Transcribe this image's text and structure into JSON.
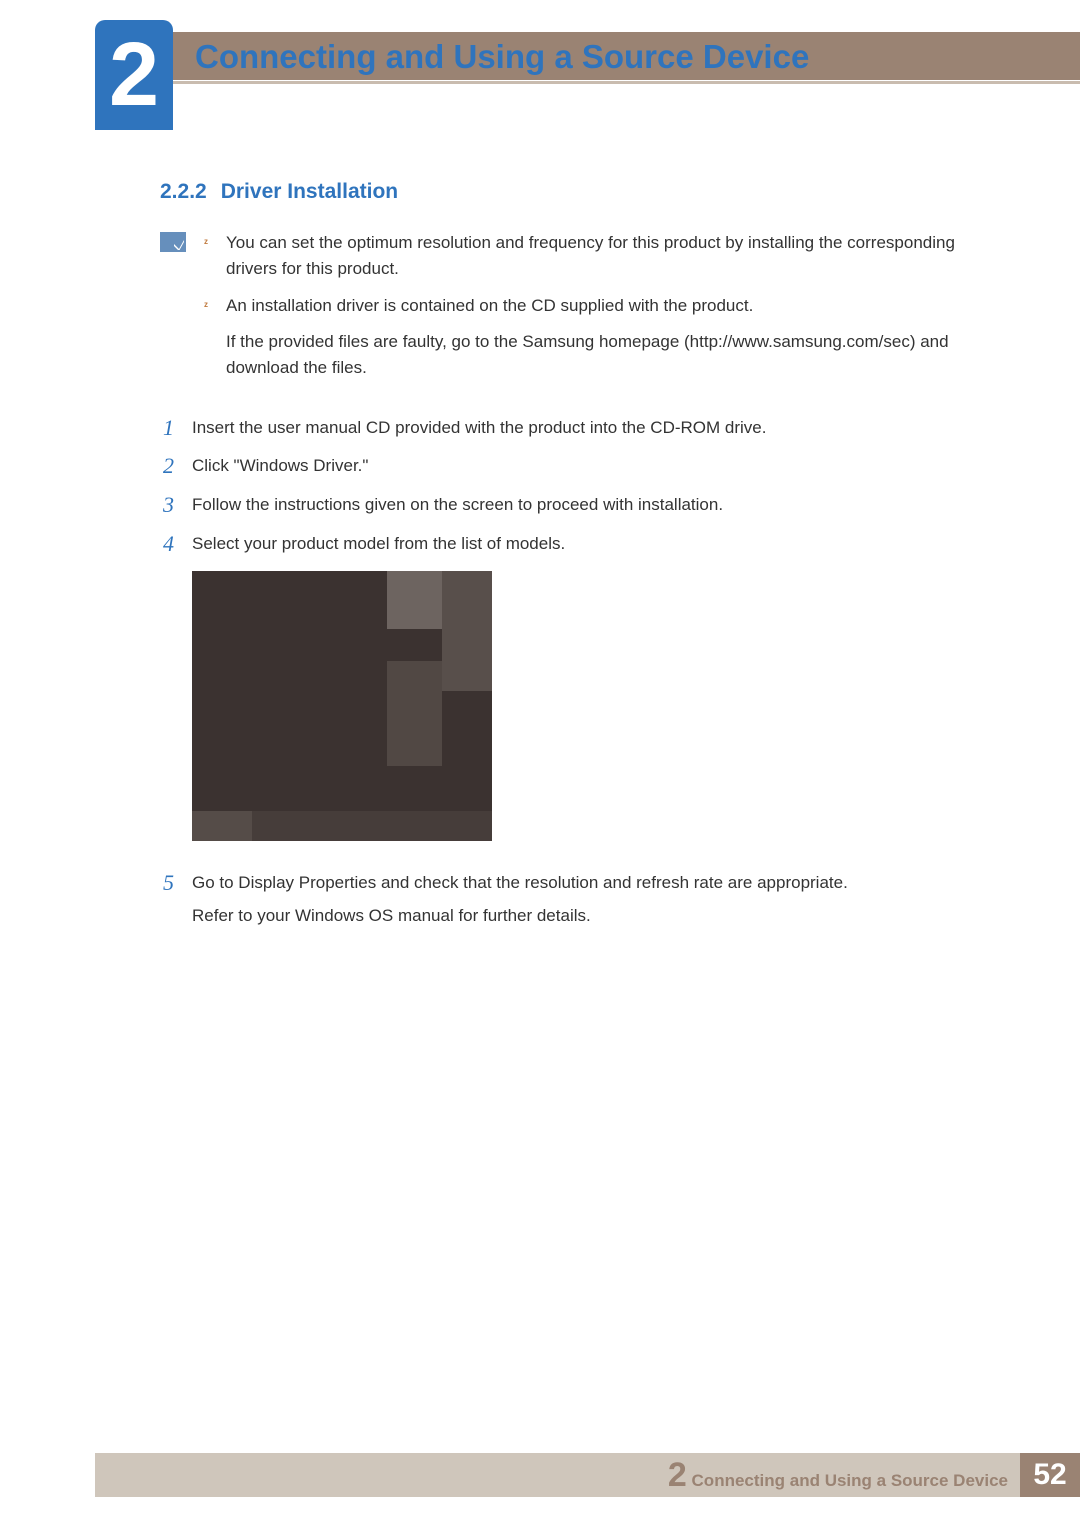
{
  "chapter": {
    "number": "2",
    "title": "Connecting and Using a Source Device"
  },
  "section": {
    "number": "2.2.2",
    "title": "Driver Installation"
  },
  "notes": [
    "You can set the optimum resolution and frequency for this product by installing the corresponding drivers for this product.",
    "An installation driver is contained on the CD supplied with the product."
  ],
  "note_supplement": "If the provided files are faulty, go to the Samsung homepage (http://www.samsung.com/sec) and download the files.",
  "steps": [
    {
      "n": "1",
      "text": "Insert the user manual CD provided with the product into the CD-ROM drive."
    },
    {
      "n": "2",
      "text": "Click \"Windows Driver.\""
    },
    {
      "n": "3",
      "text": "Follow the instructions given on the screen to proceed with installation."
    },
    {
      "n": "4",
      "text": "Select your product model from the list of models."
    },
    {
      "n": "5",
      "text": "Go to Display Properties and check that the resolution and refresh rate are appropriate."
    }
  ],
  "step5_supplement": "Refer to your Windows OS manual for further details.",
  "footer": {
    "chapter_ref_num": "2",
    "chapter_ref_title": "Connecting and Using a Source Device",
    "page": "52"
  }
}
